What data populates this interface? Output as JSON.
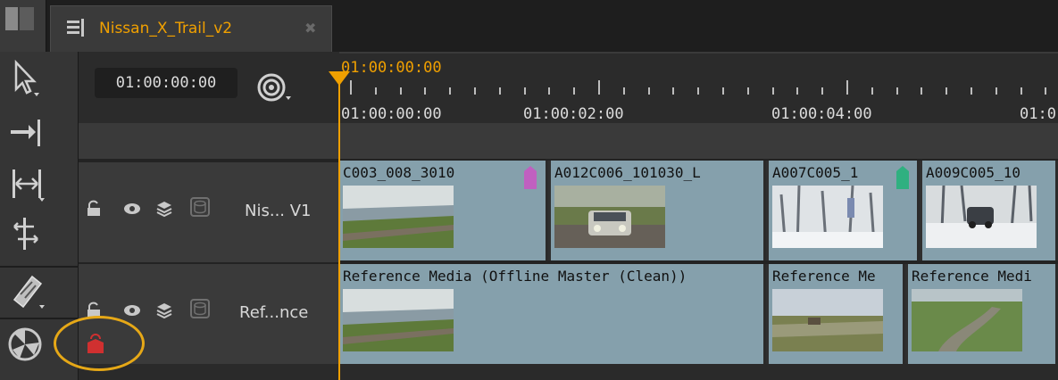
{
  "tab": {
    "title": "Nissan_X_Trail_v2",
    "close_glyph": "✖"
  },
  "timecode": {
    "current": "01:00:00:00"
  },
  "ruler": {
    "playhead_tc": "01:00:00:00",
    "labels": [
      "01:00:00:00",
      "01:00:02:00",
      "01:00:04:00",
      "01:0"
    ]
  },
  "tracks": [
    {
      "name": "Nis... V1",
      "clips": [
        {
          "name": "C003_008_3010",
          "tag_color": "#c060c0",
          "thumb": "coast-road"
        },
        {
          "name": "A012C006_101030_L",
          "thumb": "car-front"
        },
        {
          "name": "A007C005_1",
          "tag_color": "#30b080",
          "thumb": "snow-forest"
        },
        {
          "name": "A009C005_10",
          "thumb": "snow-car"
        }
      ]
    },
    {
      "name": "Ref...nce",
      "clips": [
        {
          "name": "Reference Media (Offline Master (Clean))",
          "thumb": "coast-road"
        },
        {
          "name": "Reference Me",
          "thumb": "field"
        },
        {
          "name": "Reference Medi",
          "thumb": "winding-road"
        }
      ]
    }
  ],
  "icons": {
    "tools": [
      "select-icon",
      "track-select-icon",
      "slip-icon",
      "multi-select-icon",
      "razor-icon",
      "settings-icon"
    ],
    "track_header": [
      "lock-icon",
      "eye-icon",
      "layers-icon",
      "disk-icon"
    ]
  },
  "colors": {
    "accent": "#f0a000",
    "clip": "#85a0ac",
    "highlight": "#e6a817",
    "red_tag": "#d03030"
  }
}
